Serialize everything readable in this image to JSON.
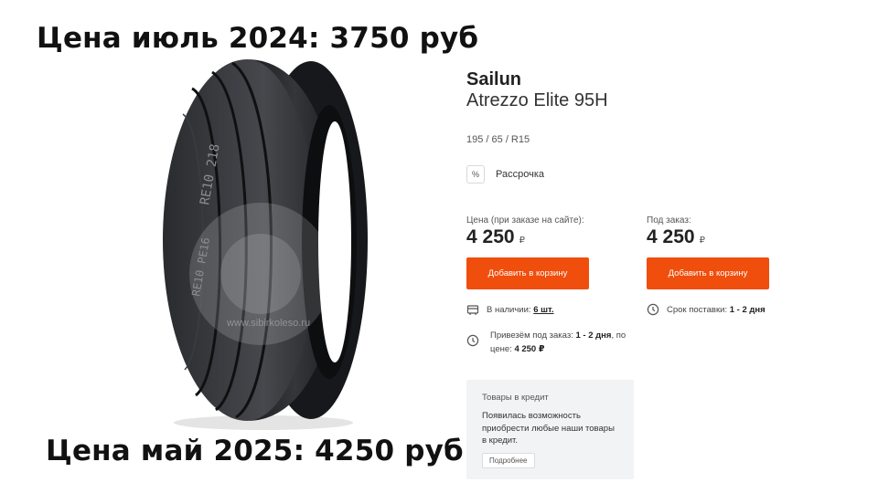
{
  "captions": {
    "top": "Цена июль 2024: 3750 руб",
    "bottom": "Цена май 2025: 4250 руб"
  },
  "image": {
    "watermark": "www.sibirkoleso.ru",
    "sidewall_text_1": "RE10  218",
    "sidewall_text_2": "RE10  PE16"
  },
  "product": {
    "brand": "Sailun",
    "model": "Atrezzo Elite 95H",
    "size": "195 / 65 / R15"
  },
  "installment": {
    "icon": "percent-icon",
    "label": "Рассрочка"
  },
  "offers": {
    "site": {
      "label": "Цена (при заказе на сайте):",
      "price": "4 250",
      "currency": "₽",
      "button": "Добавить в корзину"
    },
    "order": {
      "label": "Под заказ:",
      "price": "4 250",
      "currency": "₽",
      "button": "Добавить в корзину"
    }
  },
  "availability": {
    "stock_icon": "box-icon",
    "stock_label": "В наличии:",
    "stock_value": "6 шт.",
    "delivery_icon": "clock-icon",
    "delivery_label": "Срок поставки:",
    "delivery_value": "1 - 2 дня",
    "order_icon": "clock-icon",
    "order_prefix": "Привезём под заказ:",
    "order_days": "1 - 2 дня",
    "order_mid": ", по цене:",
    "order_price": "4 250 ₽"
  },
  "credit": {
    "title": "Товары в кредит",
    "text": "Появилась возможность приобрести любые наши товары в кредит.",
    "more": "Подробнее"
  },
  "colors": {
    "accent": "#f04e0d",
    "credit_bg": "#f2f3f5"
  }
}
